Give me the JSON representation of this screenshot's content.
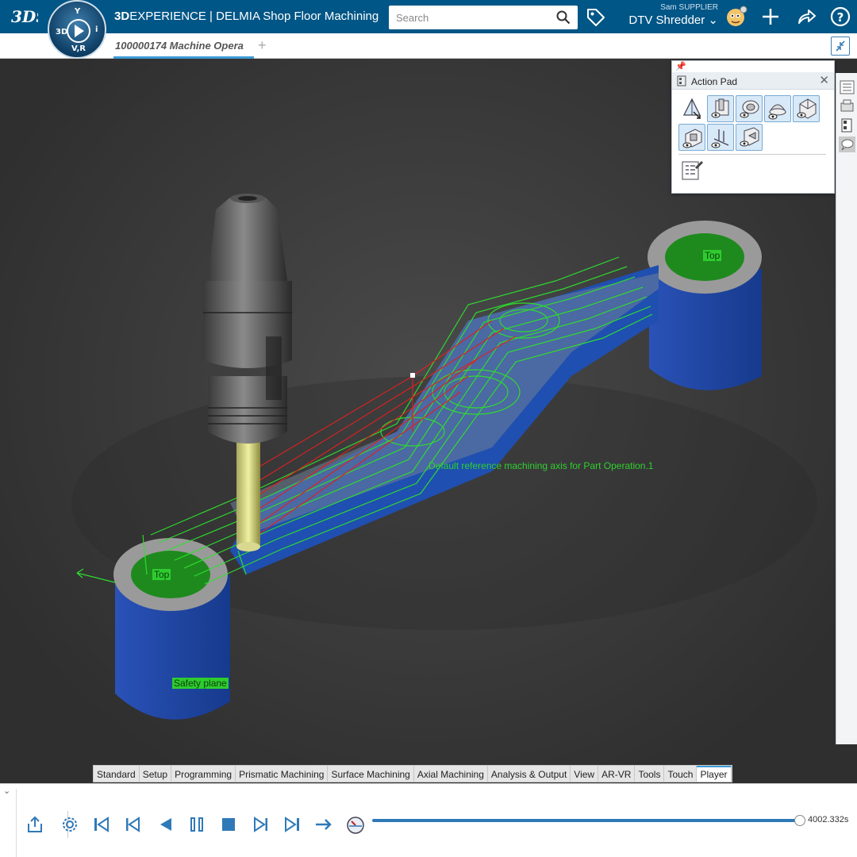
{
  "header": {
    "brand_bold": "3D",
    "brand_rest": "EXPERIENCE | DELMIA Shop Floor Machining",
    "search_placeholder": "Search",
    "user_role": "Sam SUPPLIER",
    "user_name": "DTV Shredder",
    "compass_labels": [
      "3D",
      "V,R",
      "i",
      "Y"
    ]
  },
  "tabs": {
    "active": "100000174 Machine Opera"
  },
  "viewport": {
    "labels": {
      "top_right": "Top",
      "top_left": "Top",
      "safety": "Safety plane",
      "axis": "Default reference machining axis for Part Operation.1"
    }
  },
  "action_pad": {
    "title": "Action Pad"
  },
  "command_tabs": [
    "Standard",
    "Setup",
    "Programming",
    "Prismatic Machining",
    "Surface Machining",
    "Axial Machining",
    "Analysis & Output",
    "View",
    "AR-VR",
    "Tools",
    "Touch",
    "Player"
  ],
  "player": {
    "time": "4002.332s",
    "progress": 1.0
  },
  "colors": {
    "header": "#005686",
    "accent": "#3d9bd6",
    "part_blue": "#1f4fb0",
    "toolpath_green": "#2ee02e",
    "toolpath_red": "#e02020"
  }
}
